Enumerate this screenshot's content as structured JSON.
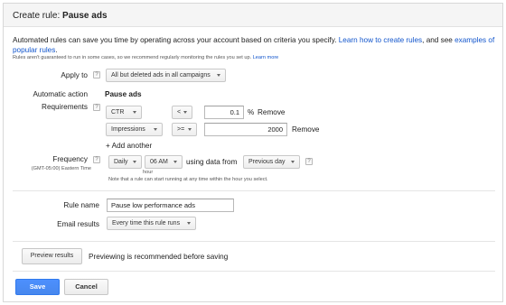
{
  "header": {
    "title_prefix": "Create rule: ",
    "title_name": "Pause ads"
  },
  "intro": {
    "text": "Automated rules can save you time by operating across your account based on criteria you specify.",
    "link1": "Learn how to create rules",
    "connector": ", and see",
    "link2": "examples of popular rules",
    "end": ".",
    "note": "Rules aren't guaranteed to run in some cases, so we recommend regularly monitoring the rules you set up.",
    "note_link": "Learn more"
  },
  "apply_to": {
    "label": "Apply to",
    "help": "?",
    "value": "All but deleted ads in all campaigns"
  },
  "automatic_action": {
    "label": "Automatic action",
    "value": "Pause ads"
  },
  "requirements": {
    "label": "Requirements",
    "help": "?",
    "rows": [
      {
        "metric": "CTR",
        "operator": "<",
        "value": "0.1",
        "unit": "%",
        "remove": "Remove"
      },
      {
        "metric": "Impressions",
        "operator": ">=",
        "value": "2000",
        "unit": "",
        "remove": "Remove"
      }
    ],
    "add_another": "+ Add another"
  },
  "frequency": {
    "label": "Frequency",
    "help": "?",
    "timezone": "(GMT-05:00) Eastern Time",
    "period": "Daily",
    "time": "06 AM",
    "time_caption": "hour",
    "using": "using data from",
    "data_range": "Previous day",
    "help2": "?",
    "note": "Note that a rule can start running at any time within the hour you select."
  },
  "rule_name": {
    "label": "Rule name",
    "value": "Pause low performance ads"
  },
  "email_results": {
    "label": "Email results",
    "value": "Every time this rule runs"
  },
  "preview": {
    "button": "Preview results",
    "text": "Previewing is recommended before saving"
  },
  "actions": {
    "save": "Save",
    "cancel": "Cancel"
  },
  "colors": {
    "link": "#1155cc",
    "primary_button": "#4d90fe",
    "header_bg": "#f5f5f5"
  }
}
